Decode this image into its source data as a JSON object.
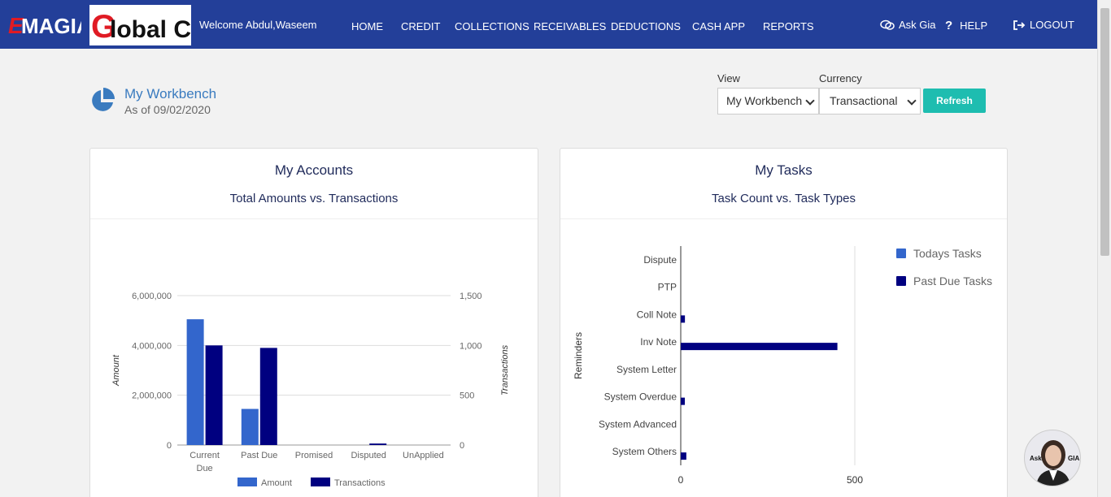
{
  "header": {
    "brand_logo": "EMAGIA",
    "company_logo_g": "G",
    "company_logo_rest": "lobal Co",
    "welcome": "Welcome Abdul,Waseem",
    "nav": [
      "HOME",
      "CREDIT",
      "COLLECTIONS",
      "RECEIVABLES",
      "DEDUCTIONS",
      "CASH APP",
      "REPORTS"
    ],
    "ask_gia": "Ask Gia",
    "help": "HELP",
    "logout": "LOGOUT"
  },
  "workbench": {
    "title": "My Workbench",
    "date": "As of 09/02/2020",
    "view_label": "View",
    "view_value": "My Workbench",
    "currency_label": "Currency",
    "currency_value": "Transactional",
    "refresh_label": "Refresh"
  },
  "accounts_panel": {
    "title": "My Accounts",
    "subtitle": "Total Amounts vs. Transactions"
  },
  "tasks_panel": {
    "title": "My Tasks",
    "subtitle": "Task Count vs. Task Types"
  },
  "chart_data": [
    {
      "type": "bar",
      "categories": [
        "Current Due",
        "Past Due",
        "Promised",
        "Disputed",
        "UnApplied"
      ],
      "category_lines": [
        [
          "Current",
          "Due"
        ],
        [
          "Past Due"
        ],
        [
          "Promised"
        ],
        [
          "Disputed"
        ],
        [
          "UnApplied"
        ]
      ],
      "series": [
        {
          "name": "Amount",
          "axis": "left",
          "color": "#3366cc",
          "values": [
            5050000,
            1450000,
            0,
            0,
            0
          ]
        },
        {
          "name": "Transactions",
          "axis": "right",
          "color": "#000080",
          "values": [
            1000,
            975,
            0,
            15,
            0
          ]
        }
      ],
      "ylabel": "Amount",
      "y2label": "Transactions",
      "ylim": [
        0,
        6000000
      ],
      "y2lim": [
        0,
        1500
      ],
      "yticks": [
        "0",
        "2,000,000",
        "4,000,000",
        "6,000,000"
      ],
      "y2ticks": [
        "0",
        "500",
        "1,000",
        "1,500"
      ],
      "grid": true,
      "legend_position": "bottom"
    },
    {
      "type": "bar",
      "orientation": "horizontal",
      "categories": [
        "Dispute",
        "PTP",
        "Coll Note",
        "Inv Note",
        "System Letter",
        "System Overdue",
        "System Advanced",
        "System Others"
      ],
      "series": [
        {
          "name": "Todays Tasks",
          "color": "#3366cc",
          "values": [
            0,
            0,
            0,
            0,
            0,
            0,
            0,
            0
          ]
        },
        {
          "name": "Past Due Tasks",
          "color": "#000080",
          "values": [
            0,
            0,
            12,
            450,
            0,
            10,
            0,
            16
          ]
        }
      ],
      "ylabel": "Reminders",
      "xlim": [
        0,
        500
      ],
      "xticks": [
        "0",
        "500"
      ],
      "grid": true,
      "legend_position": "right"
    }
  ],
  "colors": {
    "header_bg": "#233f99",
    "accent": "#1ebdb0",
    "title_blue": "#3a7bbf"
  }
}
